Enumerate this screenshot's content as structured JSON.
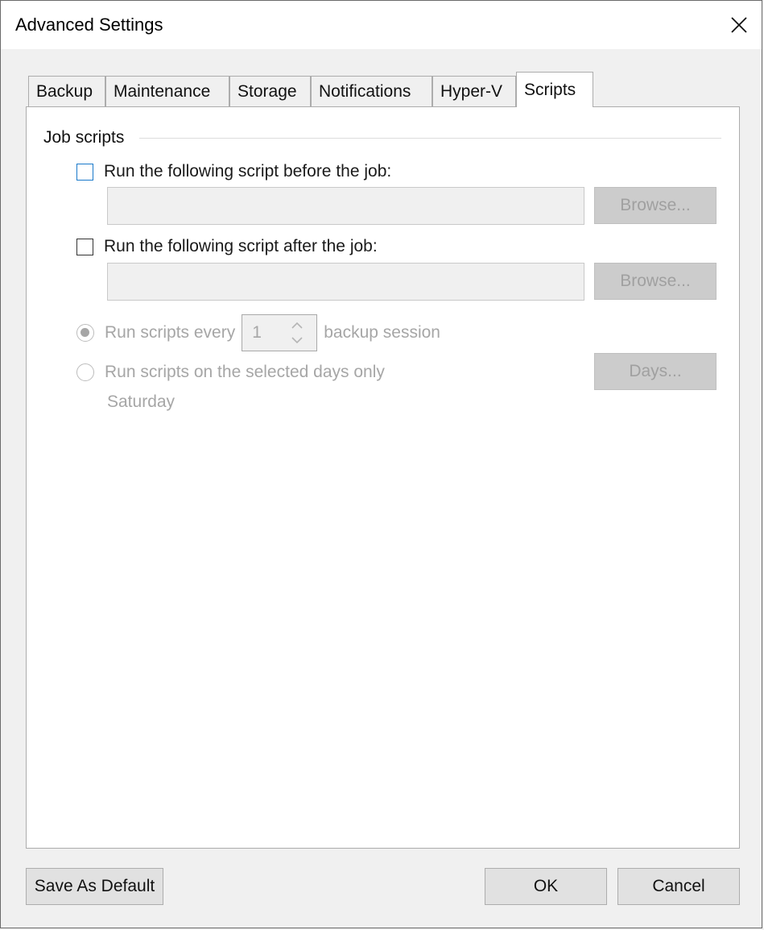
{
  "window": {
    "title": "Advanced Settings",
    "close_icon": "close-icon"
  },
  "tabs": [
    {
      "label": "Backup",
      "active": false
    },
    {
      "label": "Maintenance",
      "active": false
    },
    {
      "label": "Storage",
      "active": false
    },
    {
      "label": "Notifications",
      "active": false
    },
    {
      "label": "Hyper-V",
      "active": false
    },
    {
      "label": "Scripts",
      "active": true
    }
  ],
  "job_scripts": {
    "group_label": "Job scripts",
    "before": {
      "label": "Run the following script before the job:",
      "checked": false,
      "value": "",
      "browse_label": "Browse..."
    },
    "after": {
      "label": "Run the following script after the job:",
      "checked": false,
      "value": "",
      "browse_label": "Browse..."
    },
    "schedule": {
      "every_label_prefix": "Run scripts every",
      "every_value": "1",
      "every_label_suffix": "backup session",
      "every_selected": true,
      "days_label": "Run scripts on the selected days only",
      "days_selected": false,
      "days_button_label": "Days...",
      "selected_days": "Saturday"
    }
  },
  "footer": {
    "save_default_label": "Save As Default",
    "ok_label": "OK",
    "cancel_label": "Cancel"
  }
}
